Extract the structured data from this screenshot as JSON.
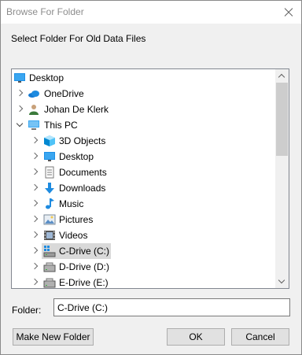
{
  "window": {
    "title": "Browse For Folder"
  },
  "description": "Select Folder For Old Data Files",
  "tree": [
    {
      "label": "Desktop",
      "icon": "desktop-icon",
      "arrow": "none",
      "level": 0
    },
    {
      "label": "OneDrive",
      "icon": "onedrive-icon",
      "arrow": "right",
      "level": 1
    },
    {
      "label": "Johan De Klerk",
      "icon": "user-folder-icon",
      "arrow": "right",
      "level": 1
    },
    {
      "label": "This PC",
      "icon": "this-pc-icon",
      "arrow": "down",
      "level": 1
    },
    {
      "label": "3D Objects",
      "icon": "3d-objects-icon",
      "arrow": "right",
      "level": 2
    },
    {
      "label": "Desktop",
      "icon": "desktop-icon",
      "arrow": "right",
      "level": 2
    },
    {
      "label": "Documents",
      "icon": "documents-icon",
      "arrow": "right",
      "level": 2
    },
    {
      "label": "Downloads",
      "icon": "downloads-icon",
      "arrow": "right",
      "level": 2
    },
    {
      "label": "Music",
      "icon": "music-icon",
      "arrow": "right",
      "level": 2
    },
    {
      "label": "Pictures",
      "icon": "pictures-icon",
      "arrow": "right",
      "level": 2
    },
    {
      "label": "Videos",
      "icon": "videos-icon",
      "arrow": "right",
      "level": 2
    },
    {
      "label": "C-Drive (C:)",
      "icon": "windows-drive-icon",
      "arrow": "right",
      "level": 2,
      "selected": true
    },
    {
      "label": "D-Drive (D:)",
      "icon": "drive-icon",
      "arrow": "right",
      "level": 2
    },
    {
      "label": "E-Drive (E:)",
      "icon": "drive-icon",
      "arrow": "right",
      "level": 2
    }
  ],
  "folder": {
    "label": "Folder:",
    "value": "C-Drive (C:)"
  },
  "buttons": {
    "new_folder": "Make New Folder",
    "ok": "OK",
    "cancel": "Cancel"
  },
  "colors": {
    "selection": "#d9d9d9",
    "button_face": "#e1e1e1",
    "dialog_bg": "#f0f0f0"
  }
}
